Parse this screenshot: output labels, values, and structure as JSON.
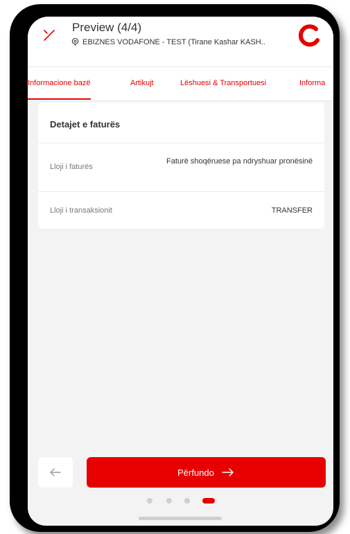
{
  "header": {
    "title": "Preview (4/4)",
    "subtitle": "EBIZNES VODAFONE - TEST (Tirane Kashar KASH..",
    "close_icon": "close-icon",
    "location_icon": "location-pin-icon",
    "logo_icon": "vodafone-logo-icon"
  },
  "tabs": [
    {
      "label": "Informacione bazë",
      "active": true
    },
    {
      "label": "Artikujt",
      "active": false
    },
    {
      "label": "Lëshuesi & Transportuesi",
      "active": false
    },
    {
      "label": "Informa",
      "active": false
    }
  ],
  "card": {
    "title": "Detajet e faturës",
    "rows": [
      {
        "label": "Lloji i faturës",
        "value": "Faturë shoqëruese pa ndryshuar pronësinë"
      },
      {
        "label": "Lloji i transaksionit",
        "value": "TRANSFER"
      }
    ]
  },
  "footer": {
    "back_icon": "arrow-left-icon",
    "primary_label": "Përfundo",
    "primary_icon": "arrow-right-icon",
    "steps_total": 4,
    "step_current": 4
  },
  "colors": {
    "accent": "#e60000",
    "background": "#f3f3f3",
    "card": "#ffffff"
  }
}
